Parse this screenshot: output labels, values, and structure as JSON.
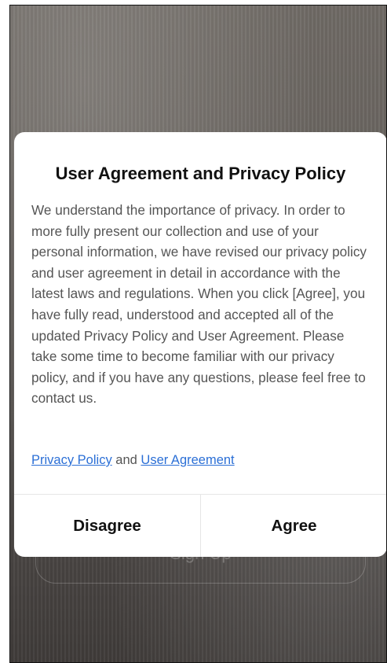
{
  "background": {
    "signup_label": "Sign Up"
  },
  "dialog": {
    "title": "User Agreement and Privacy Policy",
    "body": "We understand the importance of privacy. In order to more fully present our collection and use of your personal information, we have revised our privacy policy and user agreement in detail in accordance with the latest laws and regulations. When you click [Agree], you have fully read, understood and accepted all of the updated Privacy Policy and User Agreement. Please take some time to become familiar with our privacy policy, and if you have any questions, please feel free to contact us.",
    "links": {
      "privacy_policy": "Privacy Policy",
      "connector": "and",
      "user_agreement": "User Agreement"
    },
    "disagree_label": "Disagree",
    "agree_label": "Agree"
  },
  "colors": {
    "link": "#2b6fd6",
    "dialog_bg": "#ffffff",
    "title_text": "#111111",
    "body_text": "#555555",
    "backdrop": "#5f5a56"
  }
}
